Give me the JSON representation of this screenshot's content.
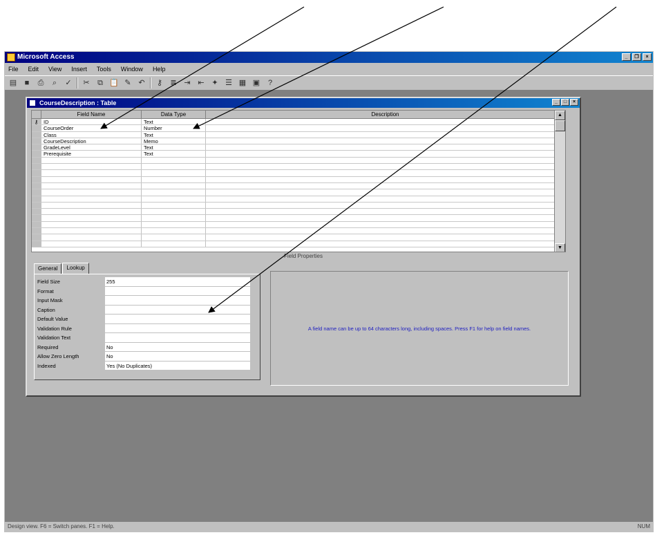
{
  "app": {
    "title": "Microsoft Access",
    "menu": [
      "File",
      "Edit",
      "View",
      "Insert",
      "Tools",
      "Window",
      "Help"
    ]
  },
  "doc": {
    "title": "CourseDescription : Table",
    "headers": {
      "name": "Field Name",
      "type": "Data Type",
      "description": "Description"
    },
    "fields": [
      {
        "name": "ID",
        "type": "Text"
      },
      {
        "name": "CourseOrder",
        "type": "Number"
      },
      {
        "name": "Class",
        "type": "Text"
      },
      {
        "name": "CourseDescription",
        "type": "Memo"
      },
      {
        "name": "GradeLevel",
        "type": "Text"
      },
      {
        "name": "Prerequisite",
        "type": "Text"
      }
    ]
  },
  "field_properties": {
    "label": "Field Properties",
    "tabs": [
      "General",
      "Lookup"
    ],
    "rows": [
      {
        "label": "Field Size",
        "value": "255"
      },
      {
        "label": "Format",
        "value": ""
      },
      {
        "label": "Input Mask",
        "value": ""
      },
      {
        "label": "Caption",
        "value": ""
      },
      {
        "label": "Default Value",
        "value": ""
      },
      {
        "label": "Validation Rule",
        "value": ""
      },
      {
        "label": "Validation Text",
        "value": ""
      },
      {
        "label": "Required",
        "value": "No"
      },
      {
        "label": "Allow Zero Length",
        "value": "No"
      },
      {
        "label": "Indexed",
        "value": "Yes (No Duplicates)"
      }
    ],
    "hint": "A field name can be up to 64 characters long, including spaces. Press F1 for help on field names."
  },
  "status": {
    "text": "Design view. F6 = Switch panes. F1 = Help.",
    "right": "NUM"
  }
}
